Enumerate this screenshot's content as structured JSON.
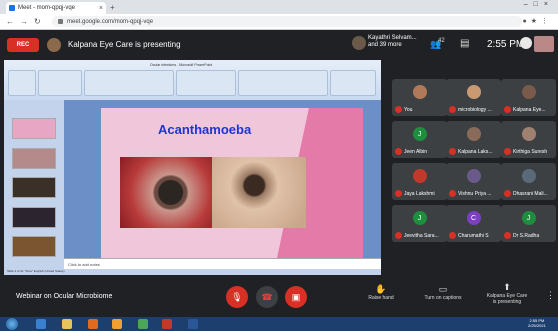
{
  "browser": {
    "tab_title": "Meet - mom-qpqj-vqe",
    "url": "meet.google.com/mom-qpqj-vqe"
  },
  "meet_header": {
    "rec_label": "REC",
    "presenting_text": "Kalpana Eye Care is presenting",
    "participants_line1": "Kayathri Selvam...",
    "participants_line2": "and 39 more",
    "people_count": "42",
    "time": "2:55 PM",
    "self_label": "You"
  },
  "powerpoint": {
    "window_title": "Ocular infections - Microsoft PowerPoint",
    "notes_placeholder": "Click to add notes",
    "status_text": "Slide 2 of 21   \"Flow\"   English (United States)"
  },
  "slide": {
    "title": "Acanthamoeba"
  },
  "participants": [
    {
      "name": "You",
      "initial": ""
    },
    {
      "name": "microbiology ...",
      "initial": ""
    },
    {
      "name": "Kalpana Eye...",
      "initial": ""
    },
    {
      "name": "Jeen Albin",
      "initial": "J"
    },
    {
      "name": "Kalpana Laks...",
      "initial": ""
    },
    {
      "name": "Kirthiga Suresh",
      "initial": ""
    },
    {
      "name": "Jaya Lakshmi",
      "initial": ""
    },
    {
      "name": "Vishnu Priya ...",
      "initial": ""
    },
    {
      "name": "Dhasrani Mali...",
      "initial": ""
    },
    {
      "name": "Jeevitha Sara...",
      "initial": "J"
    },
    {
      "name": "Charumathi S",
      "initial": "C"
    },
    {
      "name": "Dr S.Radha",
      "initial": "J"
    }
  ],
  "bottom_bar": {
    "meeting_name": "Webinar on Ocular Microbiome",
    "raise_hand": "Raise hand",
    "captions": "Turn on captions",
    "presenting_line1": "Kalpana Eye Care",
    "presenting_line2": "is presenting"
  },
  "taskbar": {
    "time": "2:55 PM",
    "date": "2/25/2021"
  },
  "colors": {
    "rec": "#d93025",
    "slide_title": "#1e34d6",
    "meet_bg": "#202124"
  }
}
